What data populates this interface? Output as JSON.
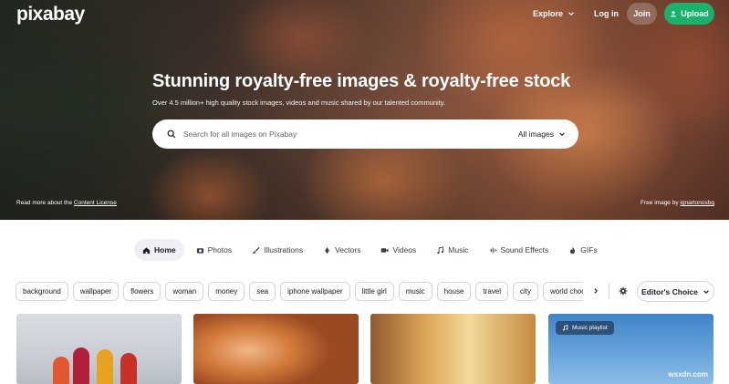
{
  "header": {
    "logo": "pixabay",
    "nav": {
      "explore": "Explore",
      "login": "Log in",
      "join": "Join",
      "upload": "Upload"
    }
  },
  "hero": {
    "title": "Stunning royalty-free images & royalty-free stock",
    "subtitle": "Over 4.5 million+ high quality stock images, videos and music shared by our talented community.",
    "search": {
      "placeholder": "Search for all images on Pixabay",
      "type": "All images"
    },
    "license_prefix": "Read more about the",
    "license_link": "Content License",
    "credit_prefix": "Free image by",
    "credit_author": "ignartonosbg"
  },
  "tabs": [
    {
      "label": "Home",
      "icon": "home-icon",
      "active": true
    },
    {
      "label": "Photos",
      "icon": "camera-icon"
    },
    {
      "label": "Illustrations",
      "icon": "brush-icon"
    },
    {
      "label": "Vectors",
      "icon": "vector-icon"
    },
    {
      "label": "Videos",
      "icon": "video-icon"
    },
    {
      "label": "Music",
      "icon": "music-icon"
    },
    {
      "label": "Sound Effects",
      "icon": "soundwave-icon"
    },
    {
      "label": "GIFs",
      "icon": "gif-icon"
    }
  ],
  "chips": [
    "background",
    "wallpaper",
    "flowers",
    "woman",
    "money",
    "sea",
    "iphone wallpaper",
    "little girl",
    "music",
    "house",
    "travel",
    "city",
    "world chocolate day"
  ],
  "filter": {
    "editors_choice": "Editor's Choice"
  },
  "gallery": {
    "music_badge": "Music playlist",
    "watermark": "wsxdn.com"
  },
  "colors": {
    "accent_green": "#19b26b",
    "text_dark": "#191b26"
  }
}
